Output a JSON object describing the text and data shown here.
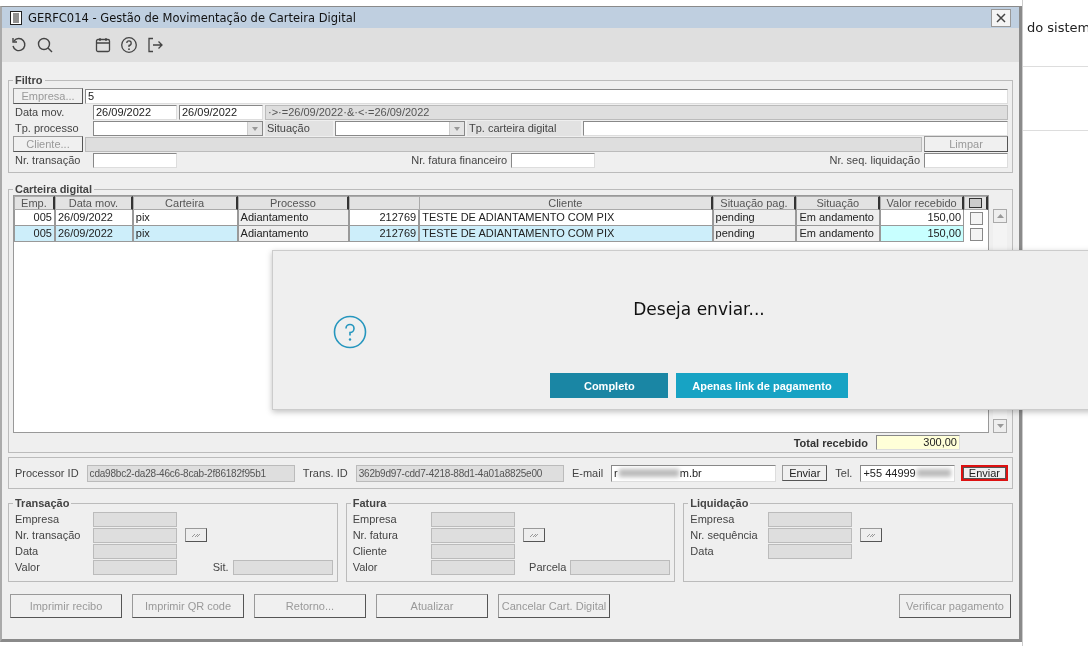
{
  "window": {
    "title": "GERFC014 - Gestão de Movimentação de Carteira Digital"
  },
  "filtro": {
    "title": "Filtro",
    "empresa_button": "Empresa...",
    "empresa_value": "5",
    "data_mov_label": "Data mov.",
    "data_from": "26/09/2022",
    "data_to": "26/09/2022",
    "data_expression": "·>·=26/09/2022·&·<·=26/09/2022",
    "tp_processo_label": "Tp. processo",
    "situacao_label": "Situação",
    "tp_carteira_label": "Tp. carteira digital",
    "cliente_button": "Cliente...",
    "limpar_button": "Limpar",
    "nr_transacao_label": "Nr. transação",
    "nr_fatura_label": "Nr. fatura financeiro",
    "nr_seq_label": "Nr. seq. liquidação"
  },
  "carteira": {
    "title": "Carteira digital",
    "columns": [
      {
        "label": "Emp.",
        "kind": "editable"
      },
      {
        "label": "Data mov.",
        "kind": "editable"
      },
      {
        "label": "Carteira",
        "kind": "editable"
      },
      {
        "label": "Processo",
        "kind": "readonly"
      },
      {
        "kind": "editable"
      },
      {
        "label": "Cliente",
        "kind": "editable"
      },
      {
        "label": "Situação pag.",
        "kind": "readonly"
      },
      {
        "label": "Situação",
        "kind": "readonly"
      },
      {
        "label": "Valor recebido",
        "kind": "value"
      }
    ],
    "rows": [
      {
        "cells": [
          "005",
          "26/09/2022",
          "pix",
          "Adiantamento",
          "212769",
          "TESTE DE ADIANTAMENTO COM PIX",
          "pending",
          "Em andamento",
          "150,00"
        ],
        "checked": false,
        "selected": false
      },
      {
        "cells": [
          "005",
          "26/09/2022",
          "pix",
          "Adiantamento",
          "212769",
          "TESTE DE ADIANTAMENTO COM PIX",
          "pending",
          "Em andamento",
          "150,00"
        ],
        "checked": false,
        "selected": true
      }
    ],
    "total_label": "Total recebido",
    "total_value": "300,00"
  },
  "envio": {
    "processor_label": "Processor ID",
    "processor_value": "cda98bc2-da28-46c6-8cab-2f86182f95b1",
    "trans_label": "Trans. ID",
    "trans_value": "362b9d97-cdd7-4218-88d1-4a01a8825e00",
    "email_label": "E-mail",
    "email_start": "r",
    "email_end": "m.br",
    "email_button": {
      "label": "Enviar",
      "focused": false
    },
    "tel_label": "Tel.",
    "tel_start": "+55 44999",
    "tel_button": {
      "label": "Enviar",
      "focused": true
    }
  },
  "groups": [
    {
      "title": "Transação",
      "fields": [
        {
          "label": "Empresa",
          "lookup": false
        },
        {
          "label": "Nr. transação",
          "lookup": true
        },
        {
          "label": "Data",
          "lookup": false
        },
        {
          "label": "Valor",
          "lookup": false
        }
      ],
      "extra_label": "Sit."
    },
    {
      "title": "Fatura",
      "fields": [
        {
          "label": "Empresa",
          "lookup": false
        },
        {
          "label": "Nr. fatura",
          "lookup": true
        },
        {
          "label": "Cliente",
          "lookup": false
        },
        {
          "label": "Valor",
          "lookup": false
        }
      ],
      "extra_label": "Parcela"
    },
    {
      "title": "Liquidação",
      "fields": [
        {
          "label": "Empresa",
          "lookup": false
        },
        {
          "label": "Nr. sequência",
          "lookup": true
        },
        {
          "label": "Data",
          "lookup": false
        }
      ]
    }
  ],
  "buttons": [
    {
      "label": "Imprimir recibo",
      "disabled": true
    },
    {
      "label": "Imprimir QR code",
      "disabled": true
    },
    {
      "label": "Retorno...",
      "disabled": true
    },
    {
      "label": "Atualizar",
      "disabled": true
    },
    {
      "label": "Cancelar Cart. Digital",
      "disabled": true
    },
    {
      "label": "Verificar pagamento",
      "disabled": true
    }
  ],
  "dialog": {
    "message": "Deseja enviar...",
    "buttons": [
      {
        "label": "Completo",
        "focused": true
      },
      {
        "label": "Apenas link de pagamento",
        "focused": false
      }
    ]
  },
  "background": {
    "text": "do sistem"
  }
}
